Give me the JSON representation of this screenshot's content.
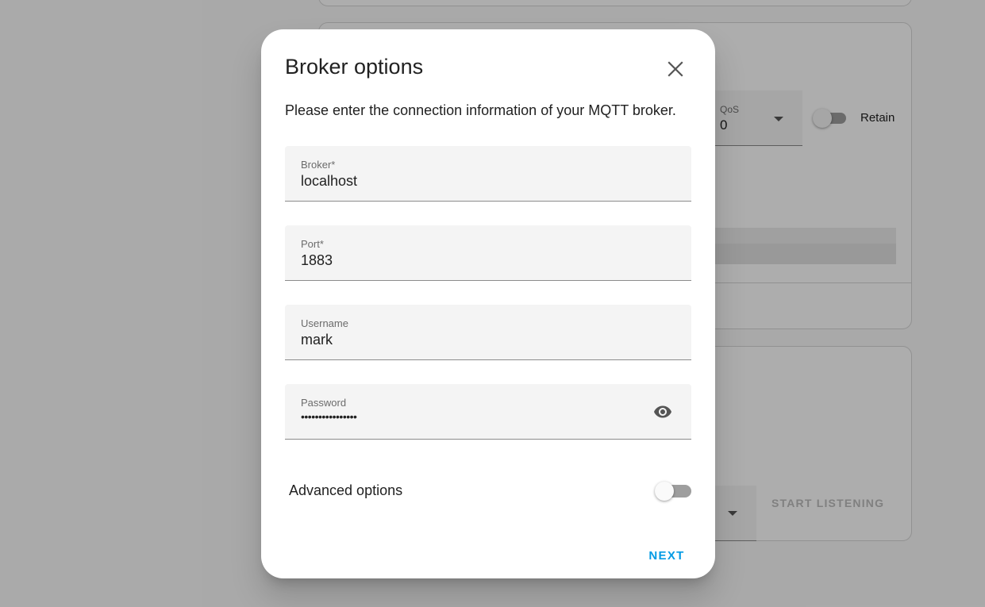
{
  "background": {
    "qos": {
      "label": "QoS",
      "value": "0"
    },
    "retain": {
      "label": "Retain",
      "checked": false
    },
    "start_listening_label": "START LISTENING"
  },
  "dialog": {
    "title": "Broker options",
    "close_icon": "close-icon",
    "intro": "Please enter the connection information of your MQTT broker.",
    "fields": {
      "broker": {
        "label": "Broker*",
        "value": "localhost"
      },
      "port": {
        "label": "Port*",
        "value": "1883"
      },
      "username": {
        "label": "Username",
        "value": "mark"
      },
      "password": {
        "label": "Password",
        "value": "••••••••••••••••",
        "toggle_icon": "eye-icon"
      }
    },
    "advanced_options": {
      "label": "Advanced options",
      "checked": false
    },
    "next_label": "NEXT"
  },
  "colors": {
    "accent": "#039be5",
    "scrim": "rgba(0,0,0,0.32)"
  }
}
